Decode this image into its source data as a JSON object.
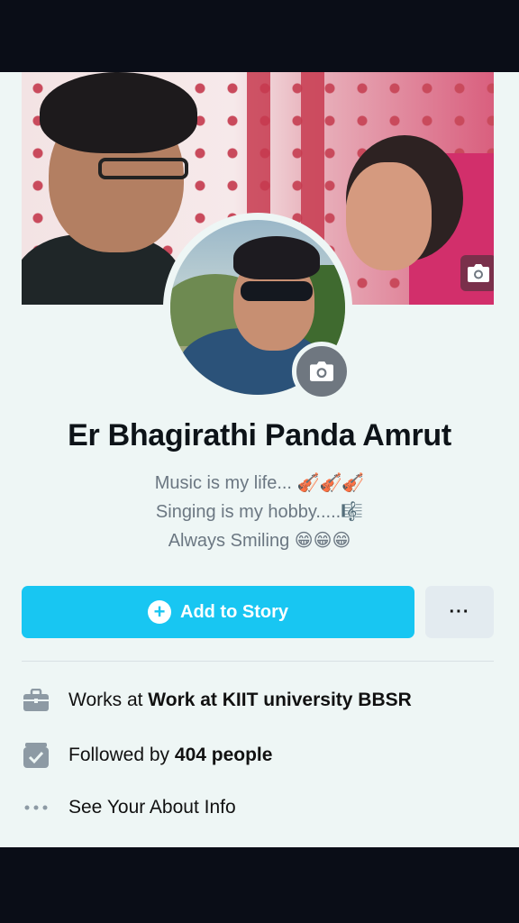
{
  "profile": {
    "name": "Er Bhagirathi Panda Amrut",
    "bio_lines": [
      "Music is my life... 🎻🎻🎻",
      "Singing is my hobby.....🎼",
      "Always Smiling 😁😁😁"
    ]
  },
  "actions": {
    "add_story_label": "Add to Story",
    "more_label": "···"
  },
  "info": {
    "work_prefix": "Works at ",
    "work_value": "Work at KIIT university BBSR",
    "followers_prefix": "Followed by ",
    "followers_value": "404 people",
    "about_label": "See Your About Info"
  },
  "icons": {
    "cover_camera": "camera-icon",
    "avatar_camera": "camera-icon",
    "add_story": "plus-circle-icon",
    "work": "briefcase-icon",
    "followers": "followers-check-icon",
    "about": "more-dots-icon"
  },
  "colors": {
    "accent": "#18c6f2",
    "background": "#eef6f5",
    "text_primary": "#0d1318",
    "text_secondary": "#6b7782"
  }
}
